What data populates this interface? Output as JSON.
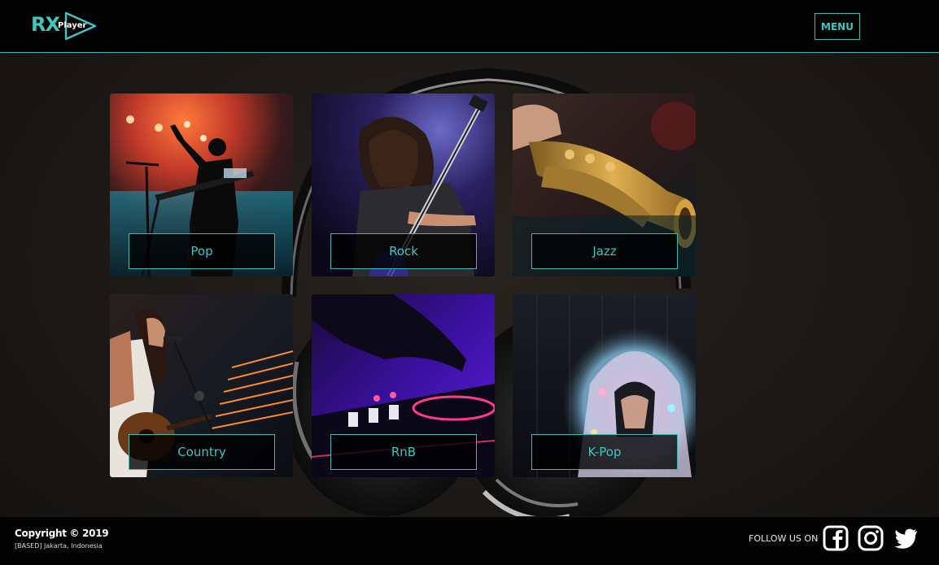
{
  "header": {
    "logo_main": "RX",
    "logo_sub": "Player",
    "menu_label": "MENU"
  },
  "genres": [
    {
      "label": "Pop"
    },
    {
      "label": "Rock"
    },
    {
      "label": "Jazz"
    },
    {
      "label": "Country"
    },
    {
      "label": "RnB"
    },
    {
      "label": "K-Pop"
    }
  ],
  "footer": {
    "copyright": "Copyright © 2019",
    "address": "[BASED] Jakarta, Indonesia",
    "follow_label": "FOLLOW US ON",
    "social": [
      {
        "icon": "facebook-icon"
      },
      {
        "icon": "instagram-icon"
      },
      {
        "icon": "twitter-icon"
      }
    ]
  },
  "colors": {
    "accent": "#3fc6c0",
    "background": "#1d1a17",
    "bar": "#020202"
  }
}
